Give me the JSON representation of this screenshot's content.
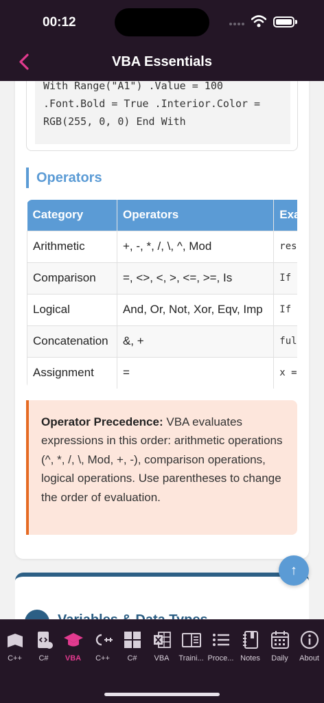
{
  "status": {
    "time": "00:12"
  },
  "nav": {
    "title": "VBA Essentials"
  },
  "code": {
    "text": "With Range(\"A1\") .Value = 100\n.Font.Bold = True .Interior.Color =\nRGB(255, 0, 0) End With"
  },
  "section": {
    "title": "Operators"
  },
  "table": {
    "headers": [
      "Category",
      "Operators",
      "Exa"
    ],
    "rows": [
      [
        "Arithmetic",
        "+, -, *, /, \\, ^, Mod",
        "res"
      ],
      [
        "Comparison",
        "=, <>, <, >, <=, >=, Is",
        "If"
      ],
      [
        "Logical",
        "And, Or, Not, Xor, Eqv, Imp",
        "If"
      ],
      [
        "Concatenation",
        "&, +",
        "ful"
      ],
      [
        "Assignment",
        "=",
        "x ="
      ]
    ]
  },
  "note": {
    "label": "Operator Precedence:",
    "text": " VBA evaluates expressions in this order: arithmetic operations (^, *, /, \\, Mod, +, -), comparison operations, logical operations. Use parentheses to change the order of evaluation."
  },
  "next_section": {
    "title": "Variables & Data Types"
  },
  "fab": {
    "label": "↑"
  },
  "tabs": [
    {
      "label": "C++",
      "icon": "book-icon"
    },
    {
      "label": "C#",
      "icon": "code-book-icon"
    },
    {
      "label": "VBA",
      "icon": "graduation-cap-icon",
      "active": true
    },
    {
      "label": "C++",
      "icon": "cpp-plus-icon"
    },
    {
      "label": "C#",
      "icon": "grid-icon"
    },
    {
      "label": "VBA",
      "icon": "excel-icon"
    },
    {
      "label": "Traini...",
      "icon": "open-book-icon"
    },
    {
      "label": "Proce...",
      "icon": "list-icon"
    },
    {
      "label": "Notes",
      "icon": "notebook-icon"
    },
    {
      "label": "Daily",
      "icon": "calendar-icon"
    },
    {
      "label": "About",
      "icon": "info-icon"
    }
  ],
  "colors": {
    "accent": "#e23a8f",
    "primary": "#5b9bd5",
    "nav_bg": "#241626",
    "note_bg": "#fde6dc",
    "note_border": "#e56a22"
  }
}
